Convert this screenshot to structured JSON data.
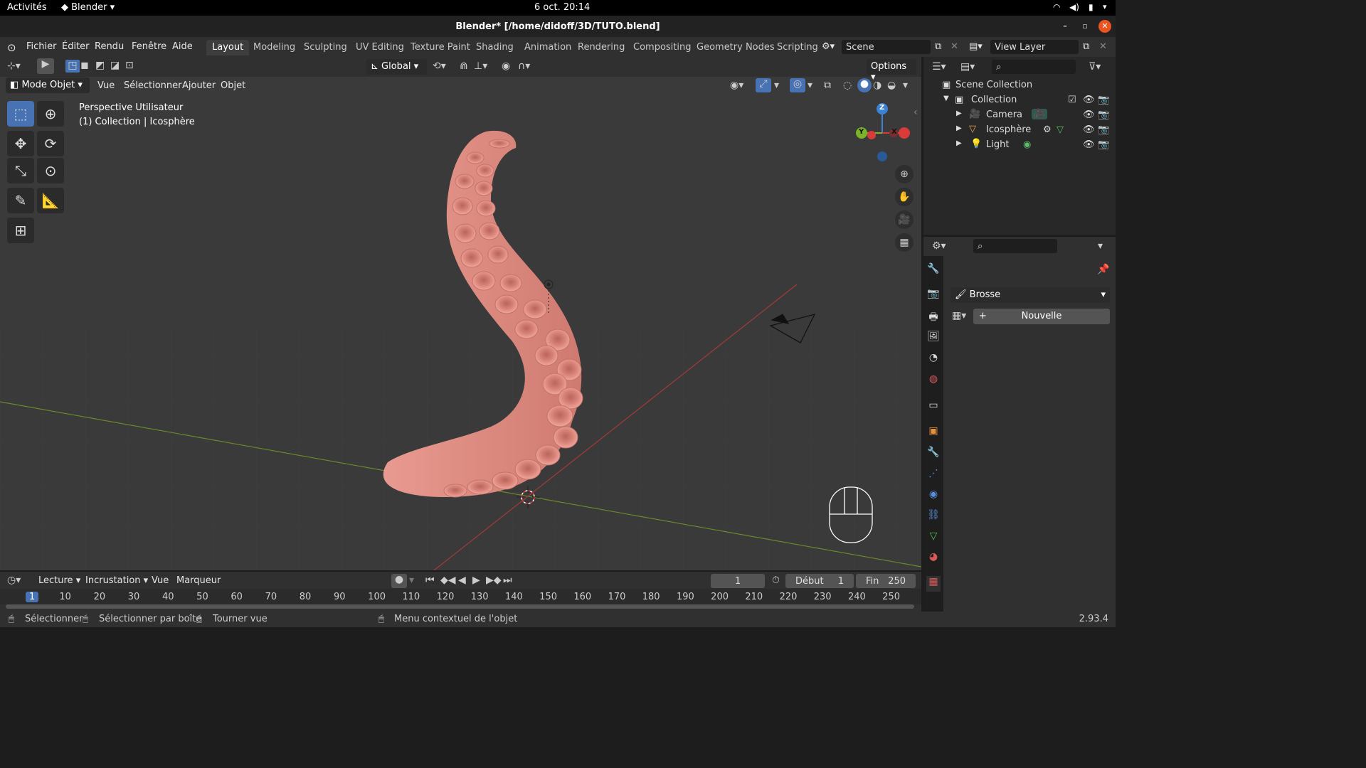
{
  "gnome": {
    "activities": "Activités",
    "app": "Blender ▾",
    "clock": "6 oct.  20:14"
  },
  "window": {
    "title": "Blender* [/home/didoff/3D/TUTO.blend]"
  },
  "menu": {
    "items": [
      "Fichier",
      "Éditer",
      "Rendu",
      "Fenêtre",
      "Aide"
    ]
  },
  "workspaces": [
    "Layout",
    "Modeling",
    "Sculpting",
    "UV Editing",
    "Texture Paint",
    "Shading",
    "Animation",
    "Rendering",
    "Compositing",
    "Geometry Nodes",
    "Scripting"
  ],
  "scene": {
    "name": "Scene",
    "view_layer": "View Layer"
  },
  "viewport": {
    "orientation": "Global",
    "options": "Options",
    "mode": "Mode Objet",
    "header_menus": [
      "Vue",
      "Sélectionner",
      "Ajouter",
      "Objet"
    ],
    "overlay_line1": "Perspective Utilisateur",
    "overlay_line2": "(1) Collection | Icosphère",
    "gizmo": {
      "z": "Z",
      "y": "Y",
      "x": "X"
    },
    "colors": {
      "tentacle": "#e08a80",
      "bg": "#3a3a3a",
      "x_axis": "#a33a3a",
      "y_axis": "#6b8a2b"
    }
  },
  "outliner": {
    "root": "Scene Collection",
    "collection": "Collection",
    "items": [
      "Camera",
      "Icosphère",
      "Light"
    ]
  },
  "properties": {
    "brush_label": "Brosse",
    "new_button": "Nouvelle"
  },
  "timeline": {
    "menus": [
      "Lecture",
      "Incrustation",
      "Vue",
      "Marqueur"
    ],
    "current_frame": "1",
    "start_label": "Début",
    "start": "1",
    "end_label": "Fin",
    "end": "250",
    "frames": [
      "1",
      "10",
      "20",
      "30",
      "40",
      "50",
      "60",
      "70",
      "80",
      "90",
      "100",
      "110",
      "120",
      "130",
      "140",
      "150",
      "160",
      "170",
      "180",
      "190",
      "200",
      "210",
      "220",
      "230",
      "240",
      "250"
    ]
  },
  "status": {
    "select": "Sélectionner",
    "box_select": "Sélectionner par boîte",
    "rotate": "Tourner vue",
    "context_menu": "Menu contextuel de l'objet",
    "version": "2.93.4"
  }
}
